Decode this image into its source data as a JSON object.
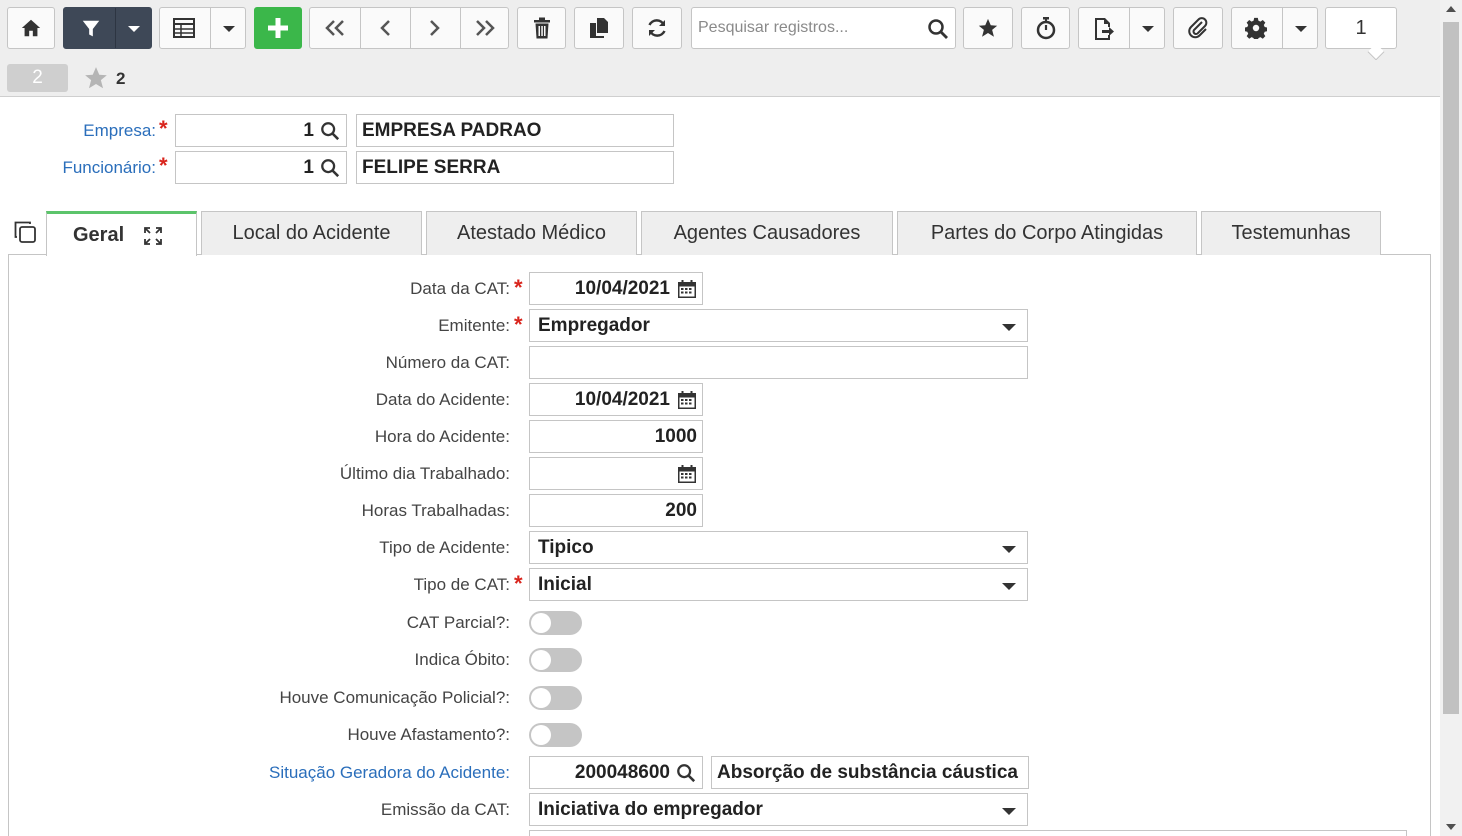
{
  "toolbar": {
    "search_placeholder": "Pesquisar registros...",
    "page_number": "1",
    "icons": [
      "home-icon",
      "filter-icon",
      "chevron-down-icon",
      "grid-icon",
      "plus-icon",
      "first-icon",
      "prev-icon",
      "next-icon",
      "last-icon",
      "trash-icon",
      "copy-icon",
      "refresh-icon",
      "search-icon",
      "star-icon",
      "stopwatch-icon",
      "export-icon",
      "paperclip-icon",
      "gear-icon"
    ]
  },
  "subbar": {
    "record_count": "2",
    "favorites_count": "2"
  },
  "header": {
    "empresa": {
      "label": "Empresa:",
      "code": "1",
      "description": "EMPRESA PADRAO"
    },
    "funcionario": {
      "label": "Funcionário:",
      "code": "1",
      "description": "FELIPE SERRA"
    }
  },
  "tabs": [
    {
      "label": "Geral",
      "active": true
    },
    {
      "label": "Local do Acidente"
    },
    {
      "label": "Atestado Médico"
    },
    {
      "label": "Agentes Causadores"
    },
    {
      "label": "Partes do Corpo Atingidas"
    },
    {
      "label": "Testemunhas"
    }
  ],
  "form": {
    "data_cat": {
      "label": "Data da CAT:",
      "value": "10/04/2021"
    },
    "emitente": {
      "label": "Emitente:",
      "value": "Empregador"
    },
    "numero_cat": {
      "label": "Número da CAT:",
      "value": ""
    },
    "data_acidente": {
      "label": "Data do Acidente:",
      "value": "10/04/2021"
    },
    "hora_acidente": {
      "label": "Hora do Acidente:",
      "value": "1000"
    },
    "ultimo_dia": {
      "label": "Último dia Trabalhado:",
      "value": ""
    },
    "horas_trabalhadas": {
      "label": "Horas Trabalhadas:",
      "value": "200"
    },
    "tipo_acidente": {
      "label": "Tipo de Acidente:",
      "value": "Tipico"
    },
    "tipo_cat": {
      "label": "Tipo de CAT:",
      "value": "Inicial"
    },
    "cat_parcial": {
      "label": "CAT Parcial?:",
      "on": false
    },
    "indica_obito": {
      "label": "Indica Óbito:",
      "on": false
    },
    "comunicacao_policial": {
      "label": "Houve Comunicação Policial?:",
      "on": false
    },
    "afastamento": {
      "label": "Houve Afastamento?:",
      "on": false
    },
    "situacao_geradora": {
      "label": "Situação Geradora do Acidente:",
      "code": "200048600",
      "description": "Absorção de substância cáustica"
    },
    "emissao_cat": {
      "label": "Emissão da CAT:",
      "value": "Iniciativa do empregador"
    }
  },
  "colors": {
    "accent_link": "#2a6ebb",
    "required": "#d9251d",
    "add_button": "#3bb74a",
    "filter_button": "#3e4857",
    "active_tab": "#5cc46b"
  }
}
